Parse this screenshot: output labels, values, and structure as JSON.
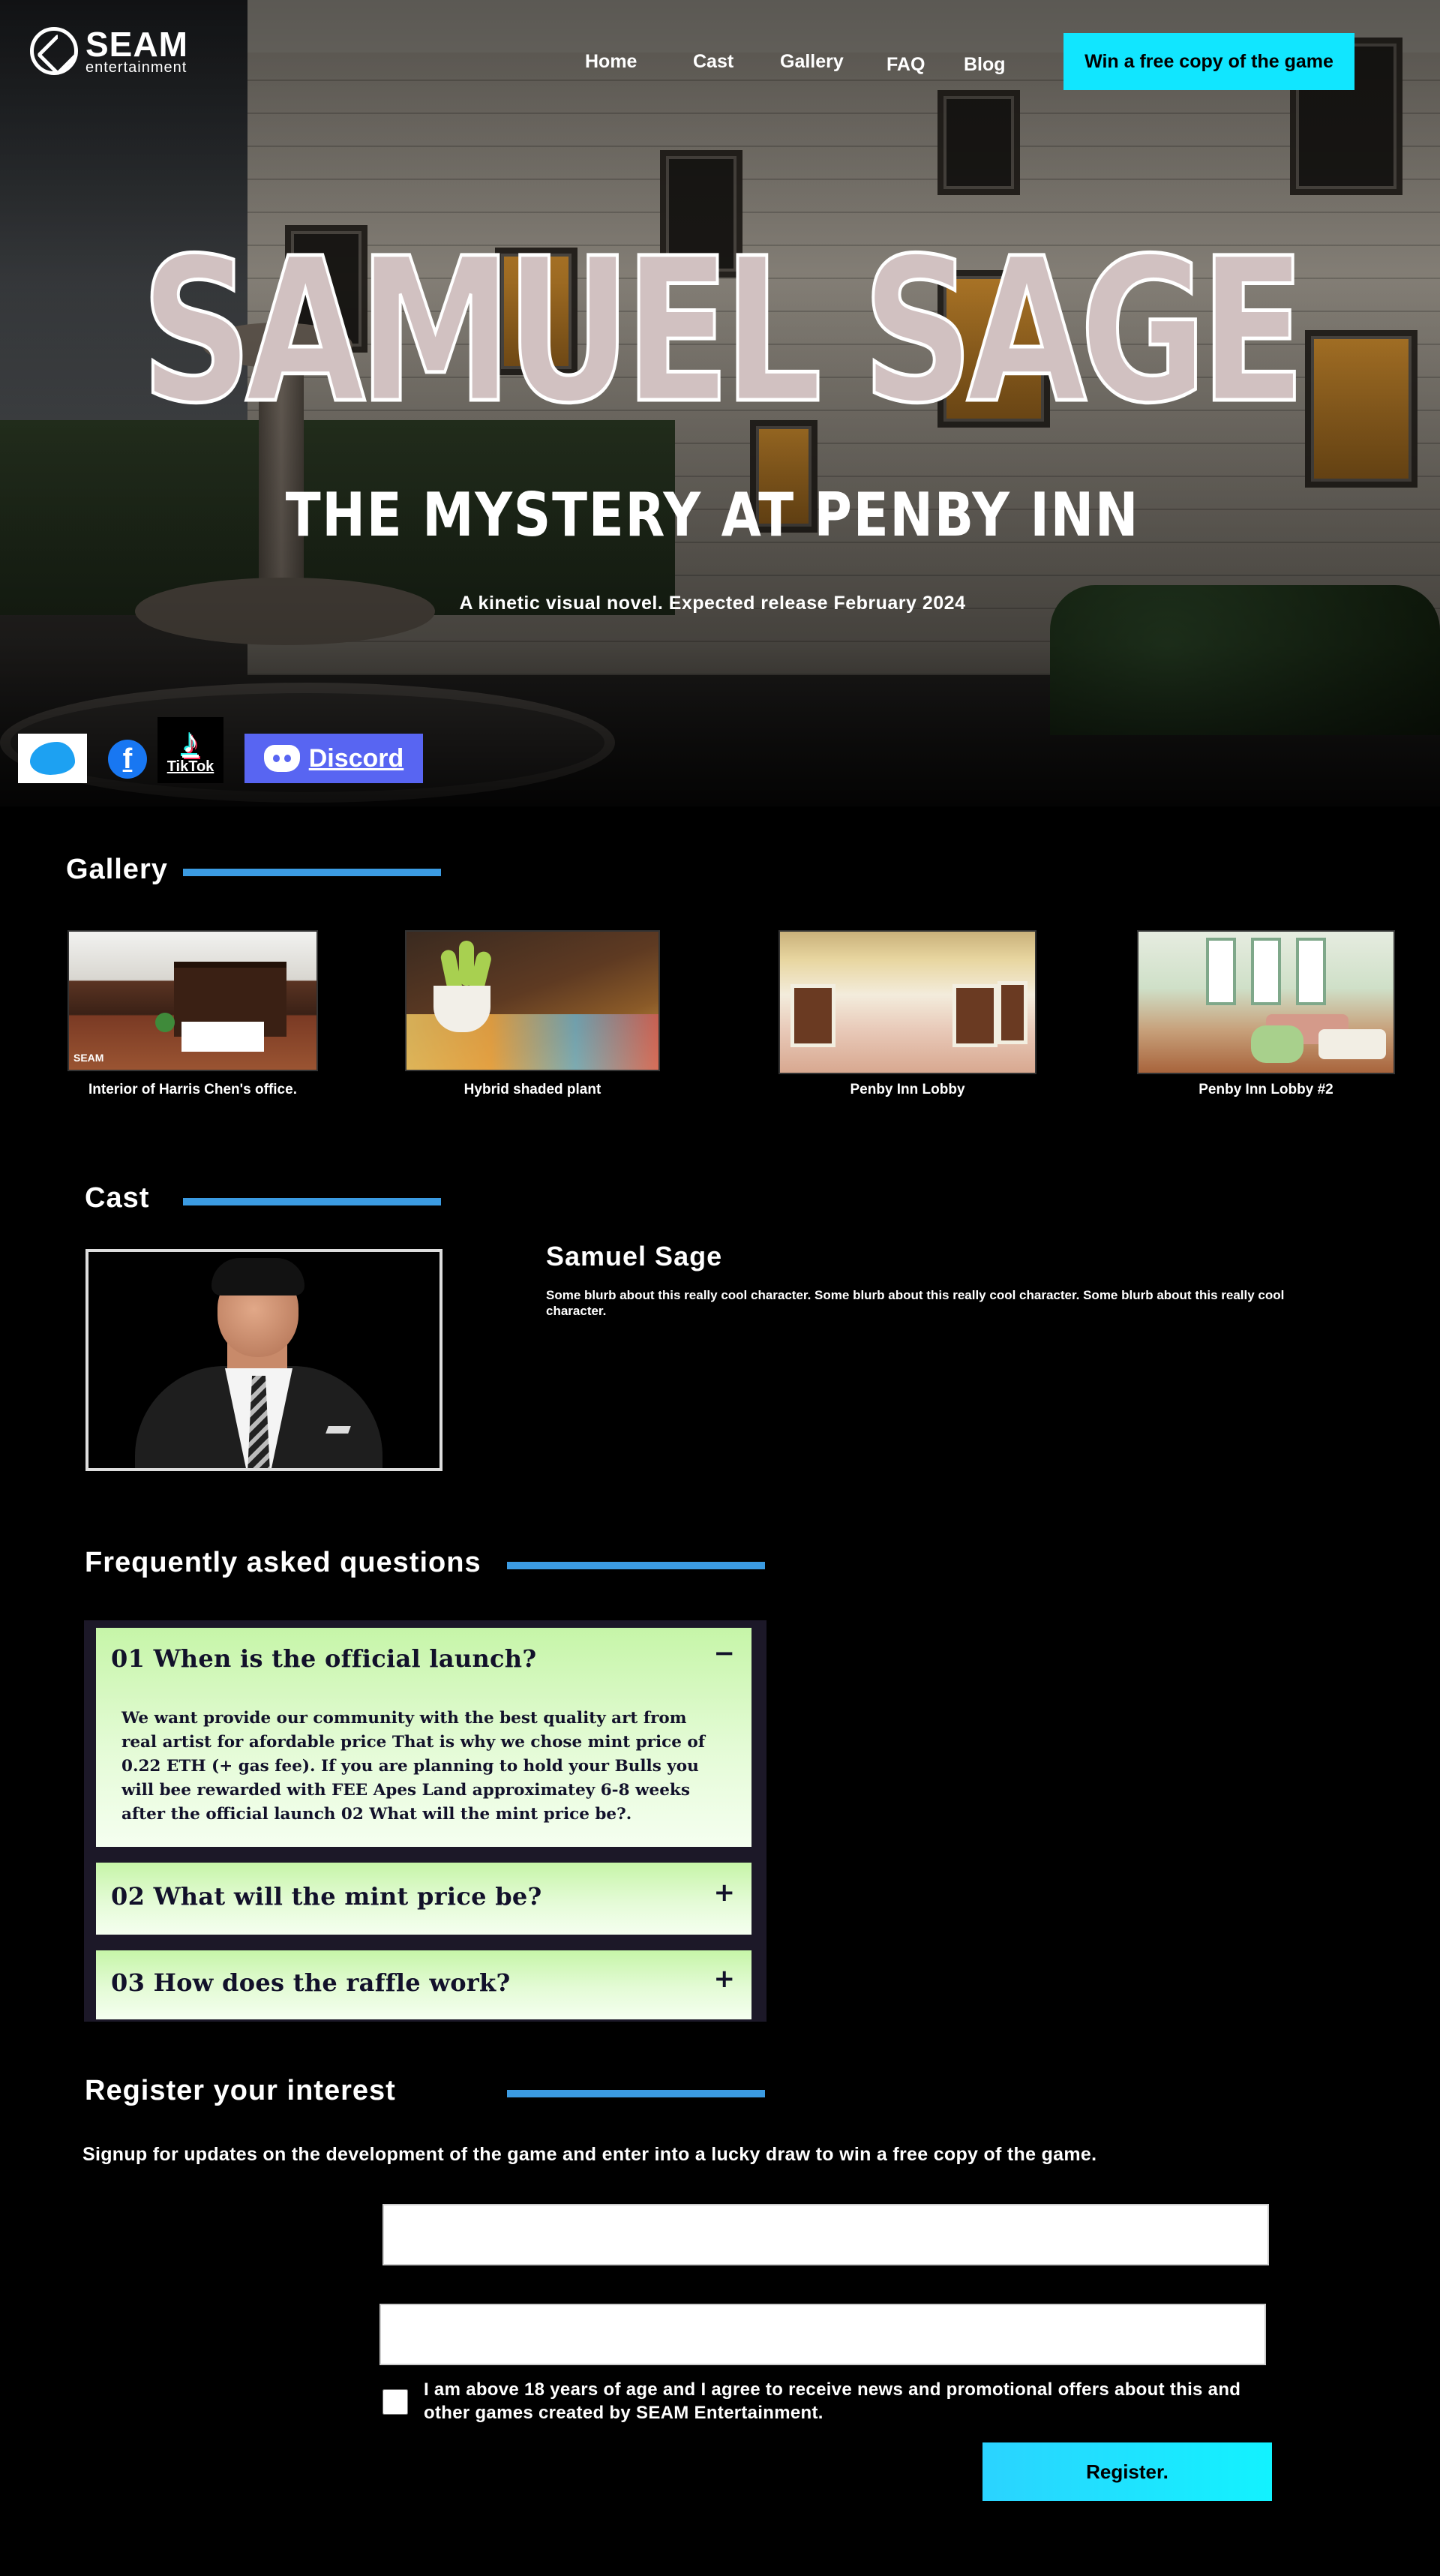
{
  "brand": {
    "name": "SEAM",
    "sub": "entertainment"
  },
  "nav": {
    "items": [
      "Home",
      "Cast",
      "Gallery",
      "FAQ",
      "Blog"
    ],
    "cta": "Win a free copy of the game"
  },
  "hero": {
    "title": "SAMUEL SAGE",
    "subtitle": "THE MYSTERY AT PENBY INN",
    "tagline": "A kinetic visual novel. Expected release February 2024"
  },
  "social": {
    "tiktok_label": "TikTok",
    "discord_label": "Discord",
    "facebook_glyph": "f",
    "icons": [
      "twitter-icon",
      "facebook-icon",
      "tiktok-icon",
      "discord-icon"
    ]
  },
  "gallery": {
    "title": "Gallery",
    "items": [
      {
        "caption": "Interior of Harris Chen's office.",
        "watermark": "SEAM"
      },
      {
        "caption": "Hybrid shaded plant"
      },
      {
        "caption": "Penby Inn Lobby"
      },
      {
        "caption": "Penby Inn Lobby #2"
      }
    ]
  },
  "cast": {
    "title": "Cast",
    "members": [
      {
        "name": "Samuel Sage",
        "bio": "Some blurb about this really cool character. Some blurb about this really cool character. Some blurb about this really cool character."
      }
    ]
  },
  "faq": {
    "title": "Frequently asked questions",
    "items": [
      {
        "question": "01 When is the official launch?",
        "toggle": "−",
        "expanded": true,
        "answer": "We want provide our community with the best quality art from real artist for afordable price That is why we chose mint price of 0.22 ETH (+ gas fee). If you are planning to hold your Bulls you will bee rewarded with FEE Apes Land approximatey 6-8 weeks after the official launch 02 What will the mint price be?."
      },
      {
        "question": "02 What will the mint price be?",
        "toggle": "+",
        "expanded": false
      },
      {
        "question": "03 How does the raffle work?",
        "toggle": "+",
        "expanded": false
      }
    ]
  },
  "register": {
    "title": "Register your interest",
    "lead": "Signup for updates on the development of the game and enter into a lucky draw to win a free copy of the game.",
    "field1_value": "",
    "field2_value": "",
    "consent": "I am above 18 years of age and I agree to receive news and promotional offers about this and other games created by SEAM Entertainment.",
    "button": "Register."
  },
  "colors": {
    "accent": "#11e6ff",
    "section_bar": "#3b9be2",
    "faq_bg": "#1c1828",
    "discord": "#5865f2"
  }
}
